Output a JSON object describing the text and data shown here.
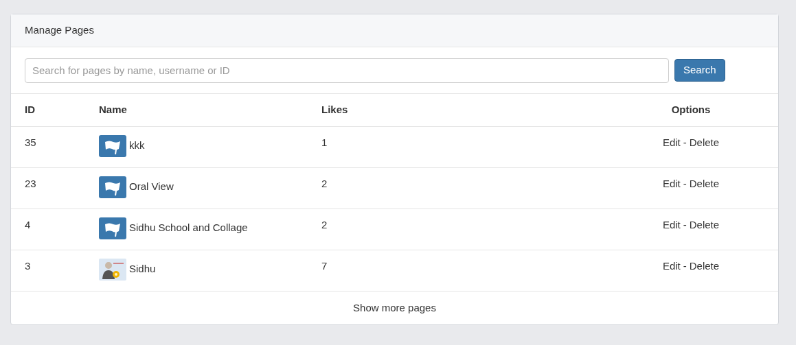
{
  "panel": {
    "title": "Manage Pages"
  },
  "search": {
    "placeholder": "Search for pages by name, username or ID",
    "button": "Search"
  },
  "table": {
    "columns": [
      "ID",
      "Name",
      "Likes",
      "Options"
    ],
    "rows": [
      {
        "id": "35",
        "kind": "flag",
        "name": "kkk",
        "likes": "1",
        "edit": "Edit",
        "separator": "-",
        "delete": "Delete"
      },
      {
        "id": "23",
        "kind": "flag",
        "name": "Oral View",
        "likes": "2",
        "edit": "Edit",
        "separator": "-",
        "delete": "Delete"
      },
      {
        "id": "4",
        "kind": "flag",
        "name": "Sidhu School and Collage",
        "likes": "2",
        "edit": "Edit",
        "separator": "-",
        "delete": "Delete"
      },
      {
        "id": "3",
        "kind": "user",
        "name": "Sidhu",
        "likes": "7",
        "edit": "Edit",
        "separator": "-",
        "delete": "Delete"
      }
    ]
  },
  "footer": {
    "link": "Show more pages"
  }
}
